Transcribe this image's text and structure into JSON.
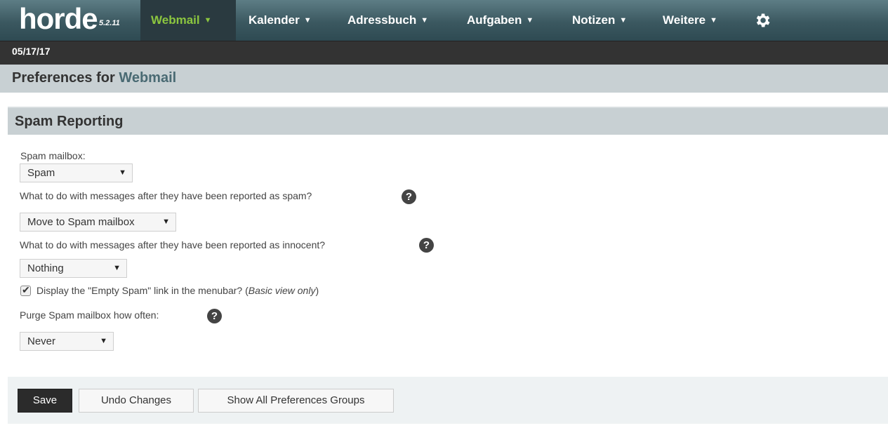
{
  "header": {
    "logo_text": "horde",
    "version": "5.2.11",
    "nav": [
      {
        "label": "Webmail",
        "active": true
      },
      {
        "label": "Kalender",
        "active": false
      },
      {
        "label": "Adressbuch",
        "active": false
      },
      {
        "label": "Aufgaben",
        "active": false
      },
      {
        "label": "Notizen",
        "active": false
      },
      {
        "label": "Weitere",
        "active": false
      }
    ],
    "settings_icon": "gear-icon",
    "caret_glyph": "▼"
  },
  "date": "05/17/17",
  "prefs": {
    "title_prefix": "Preferences for",
    "app_name": "Webmail"
  },
  "section": {
    "title": "Spam Reporting"
  },
  "form": {
    "spam_mailbox_label": "Spam mailbox:",
    "spam_mailbox_value": "Spam",
    "spam_action_label": "What to do with messages after they have been reported as spam?",
    "spam_action_value": "Move to Spam mailbox",
    "innocent_action_label": "What to do with messages after they have been reported as innocent?",
    "innocent_action_value": "Nothing",
    "empty_spam_checked": true,
    "empty_spam_label": "Display the \"Empty Spam\" link in the menubar? (",
    "empty_spam_note": "Basic view only",
    "empty_spam_close": ")",
    "purge_label": "Purge Spam mailbox how often:",
    "purge_value": "Never",
    "help_glyph": "?",
    "check_glyph": "✔"
  },
  "buttons": {
    "save": "Save",
    "undo": "Undo Changes",
    "show_all": "Show All Preferences Groups"
  },
  "colors": {
    "nav_bg": "#3b5860",
    "nav_active_text": "#8cc63f",
    "header_bar": "#c8d0d3",
    "primary_button": "#2b2b2b"
  }
}
